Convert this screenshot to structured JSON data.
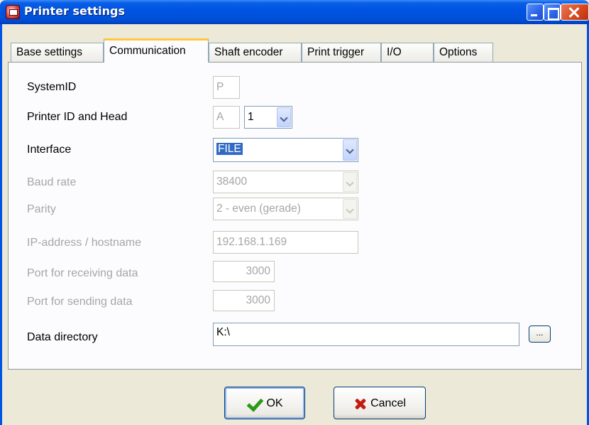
{
  "window": {
    "title": "Printer settings"
  },
  "tabs": [
    {
      "label": "Base settings"
    },
    {
      "label": "Communication"
    },
    {
      "label": "Shaft encoder"
    },
    {
      "label": "Print trigger"
    },
    {
      "label": "I/O"
    },
    {
      "label": "Options"
    }
  ],
  "active_tab": "Communication",
  "form": {
    "system_id": {
      "label": "SystemID",
      "value": "P"
    },
    "printer_id": {
      "label": "Printer ID and Head",
      "id_value": "A",
      "head_value": "1"
    },
    "interface": {
      "label": "Interface",
      "value": "FILE"
    },
    "baud_rate": {
      "label": "Baud rate",
      "value": "38400"
    },
    "parity": {
      "label": "Parity",
      "value": "2 - even (gerade)"
    },
    "ip_address": {
      "label": "IP-address / hostname",
      "value": "192.168.1.169"
    },
    "port_receive": {
      "label": "Port for receiving data",
      "value": "3000"
    },
    "port_send": {
      "label": "Port for sending data",
      "value": "3000"
    },
    "data_directory": {
      "label": "Data directory",
      "value": "K:\\",
      "browse_label": "..."
    }
  },
  "buttons": {
    "ok": "OK",
    "cancel": "Cancel"
  },
  "colors": {
    "titlebar": "#0054e3",
    "active_tab_accent": "#ffc83c",
    "selection": "#316ac5"
  }
}
